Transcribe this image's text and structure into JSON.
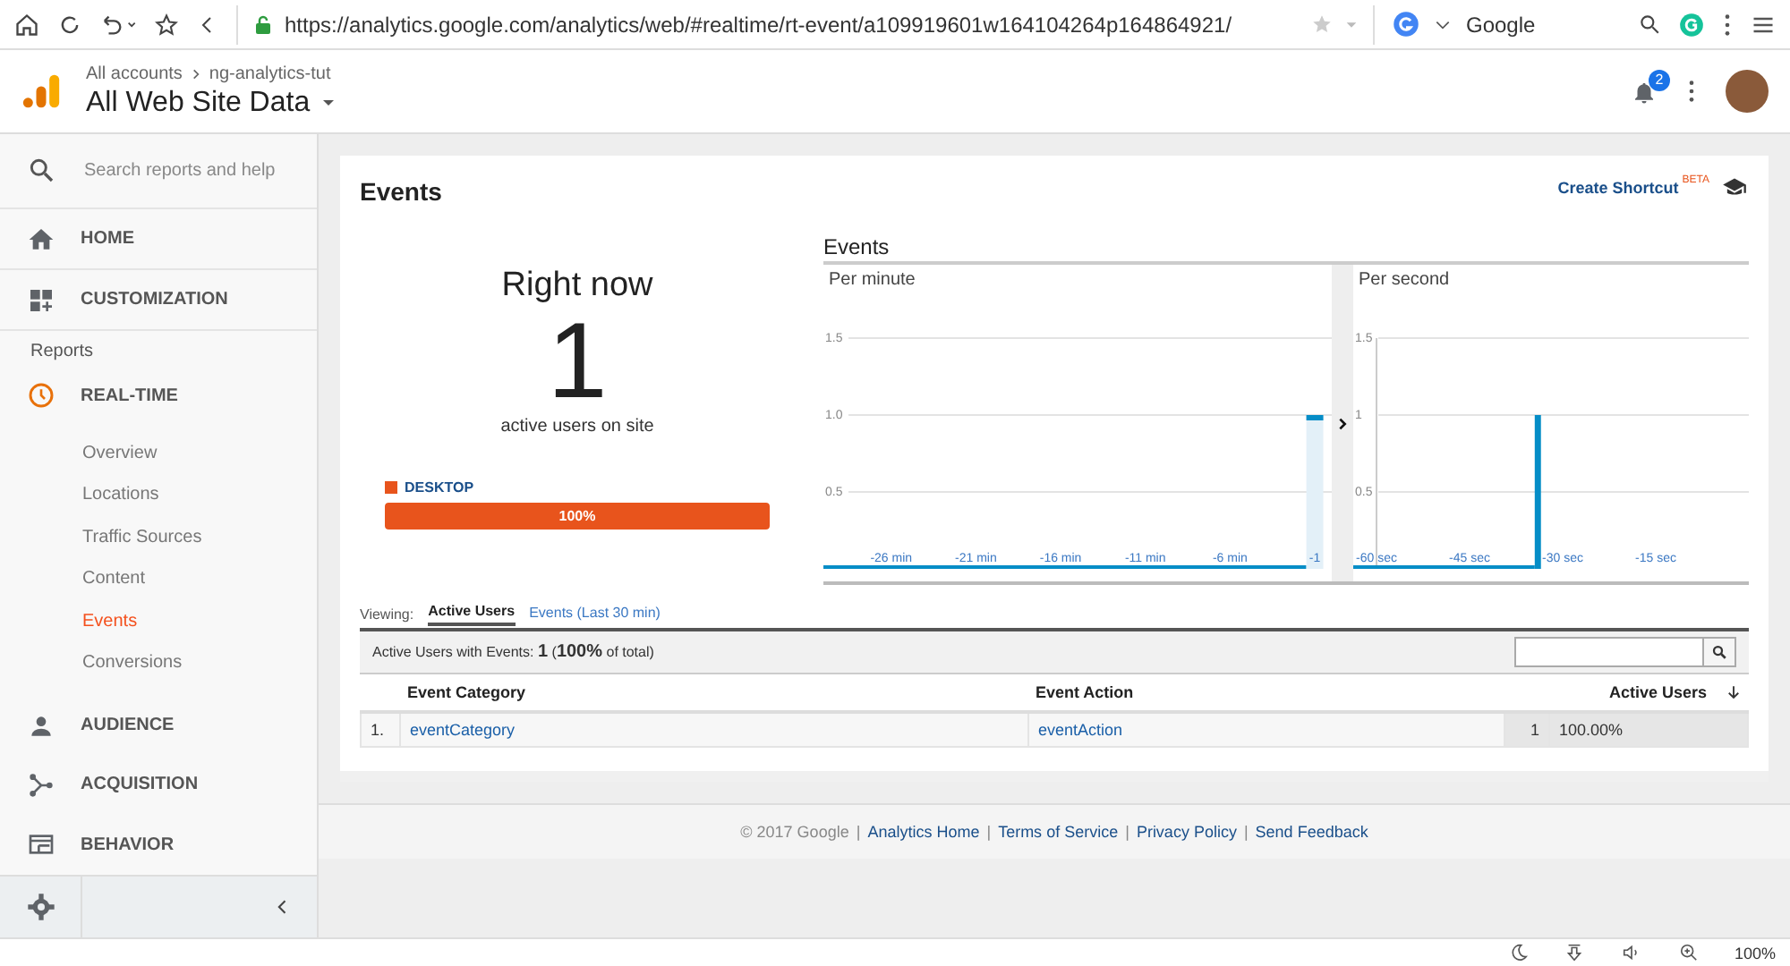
{
  "browser": {
    "url": "https://analytics.google.com/analytics/web/#realtime/rt-event/a109919601w164104264p164864921/",
    "search_engine": "Google"
  },
  "header": {
    "breadcrumb": [
      "All accounts",
      "ng-analytics-tut"
    ],
    "title": "All Web Site Data",
    "notifications": "2"
  },
  "sidebar": {
    "search_placeholder": "Search reports and help",
    "items": [
      {
        "kind": "nav",
        "label": "HOME",
        "expanded": false
      },
      {
        "kind": "nav",
        "label": "CUSTOMIZATION",
        "expanded": false
      },
      {
        "kind": "section",
        "label": "Reports"
      },
      {
        "kind": "nav",
        "label": "REAL-TIME",
        "expanded": true,
        "children": [
          {
            "label": "Overview",
            "selected": false
          },
          {
            "label": "Locations",
            "selected": false
          },
          {
            "label": "Traffic Sources",
            "selected": false
          },
          {
            "label": "Content",
            "selected": false
          },
          {
            "label": "Events",
            "selected": true
          },
          {
            "label": "Conversions",
            "selected": false
          }
        ]
      },
      {
        "kind": "nav",
        "label": "AUDIENCE",
        "expanded": false
      },
      {
        "kind": "nav",
        "label": "ACQUISITION",
        "expanded": false
      },
      {
        "kind": "nav",
        "label": "BEHAVIOR",
        "expanded": false
      }
    ]
  },
  "report": {
    "title": "Events",
    "shortcut": "Create Shortcut",
    "shortcut_badge": "BETA",
    "right_now": {
      "heading": "Right now",
      "count": "1",
      "caption": "active users on site",
      "devices": [
        {
          "label": "DESKTOP",
          "color": "#e8541c",
          "reading": "100%",
          "level": 1
        }
      ]
    },
    "events_chart": {
      "title": "Events",
      "panels": [
        {
          "chart_data": {
            "type": "bar",
            "title": "Per minute",
            "x": [
              -1
            ],
            "values": [
              1
            ],
            "xlim": [
              -30,
              0
            ],
            "ylim": [
              0,
              1.5
            ],
            "xticks": [
              {
                "value": -26,
                "label": "-26 min"
              },
              {
                "value": -21,
                "label": "-21 min"
              },
              {
                "value": -16,
                "label": "-16 min"
              },
              {
                "value": -11,
                "label": "-11 min"
              },
              {
                "value": -6,
                "label": "-6 min"
              },
              {
                "value": -1,
                "label": "-1"
              }
            ],
            "yticks": [
              {
                "value": 0.5,
                "label": "0.5"
              },
              {
                "value": 1,
                "label": "1.0"
              },
              {
                "value": 1.5,
                "label": "1.5"
              }
            ]
          }
        },
        {
          "chart_data": {
            "type": "bar",
            "title": "Per second",
            "x": [
              -34
            ],
            "values": [
              1
            ],
            "xlim": [
              -60,
              0
            ],
            "ylim": [
              0,
              1.5
            ],
            "xticks": [
              {
                "value": -60,
                "label": "-60 sec"
              },
              {
                "value": -45,
                "label": "-45 sec"
              },
              {
                "value": -30,
                "label": "-30 sec"
              },
              {
                "value": -15,
                "label": "-15 sec"
              }
            ],
            "yticks": [
              {
                "value": 0.5,
                "label": "0.5"
              },
              {
                "value": 1,
                "label": "1"
              },
              {
                "value": 1.5,
                "label": "1.5"
              }
            ]
          }
        }
      ]
    },
    "viewing": {
      "label": "Viewing:",
      "tabs": [
        {
          "label": "Active Users",
          "selected": true
        },
        {
          "label": "Events (Last 30 min)",
          "selected": false
        }
      ]
    },
    "summary": "Active Users with Events: **1** (**100%** of total)",
    "table": {
      "columns": [
        "Event Category",
        "Event Action",
        "Active Users"
      ],
      "rows": [
        {
          "index": "1.",
          "category": "eventCategory",
          "action": "eventAction",
          "users": "1",
          "share": "100.00%"
        }
      ]
    }
  },
  "footer": {
    "copyright": "© 2017 Google",
    "separator": "|",
    "links": [
      "Analytics Home",
      "Terms of Service",
      "Privacy Policy",
      "Send Feedback"
    ]
  },
  "status_bar": {
    "zoom": "100%"
  }
}
